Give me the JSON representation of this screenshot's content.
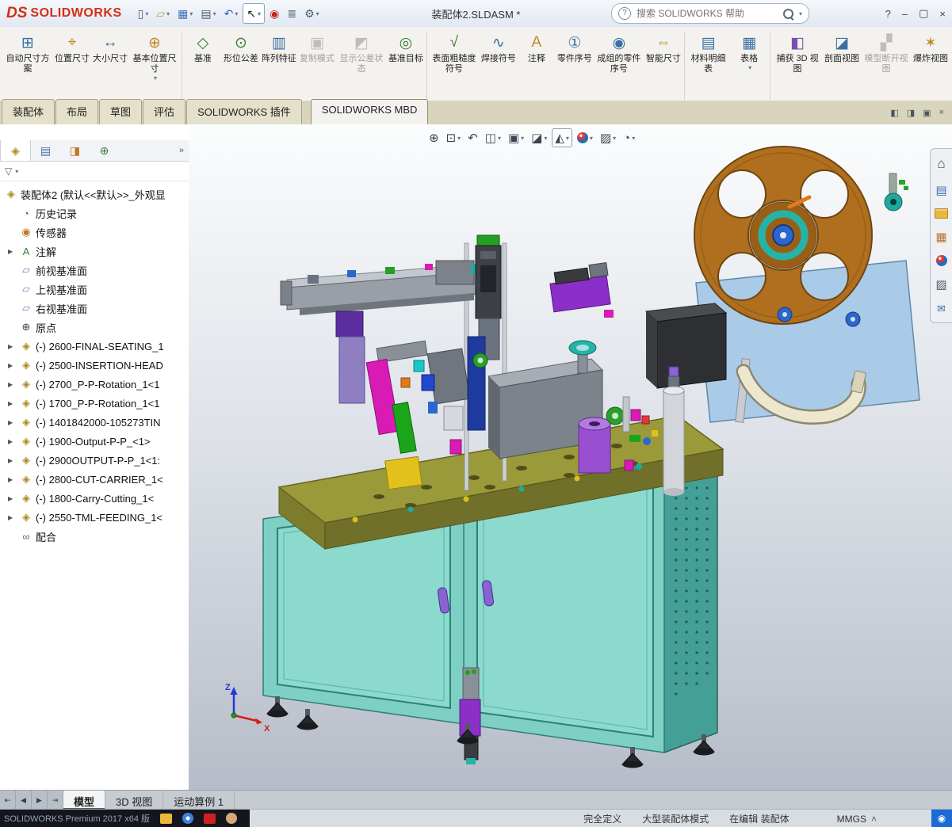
{
  "titlebar": {
    "brand_prefix": "DS",
    "brand": "SOLIDWORKS",
    "document_title": "装配体2.SLDASM *",
    "search_placeholder": "搜索 SOLIDWORKS 帮助",
    "help_glyph": "?",
    "quick_access": [
      {
        "name": "new",
        "glyph": "▯"
      },
      {
        "name": "open",
        "glyph": "▱"
      },
      {
        "name": "save",
        "glyph": "▦"
      },
      {
        "name": "print",
        "glyph": "▤"
      },
      {
        "name": "undo",
        "glyph": "↶"
      },
      {
        "name": "select",
        "glyph": "↖"
      },
      {
        "name": "rebuild-indicator",
        "glyph": "◉"
      },
      {
        "name": "file-properties",
        "glyph": "≣"
      },
      {
        "name": "options",
        "glyph": "⚙"
      }
    ],
    "window_controls": {
      "minimize": "–",
      "maximize": "▢",
      "close": "×"
    }
  },
  "ribbon": {
    "buttons": [
      {
        "label": "自动尺寸方案",
        "glyph": "⊞",
        "enabled": true,
        "dropdown": false
      },
      {
        "label": "位置尺寸",
        "glyph": "⌖",
        "enabled": true,
        "dropdown": false
      },
      {
        "label": "大小尺寸",
        "glyph": "↔",
        "enabled": true,
        "dropdown": false
      },
      {
        "label": "基本位置尺寸",
        "glyph": "⊕",
        "enabled": true,
        "dropdown": true
      },
      {
        "label": "基准",
        "glyph": "◇",
        "enabled": true,
        "dropdown": false
      },
      {
        "label": "形位公差",
        "glyph": "⊙",
        "enabled": true,
        "dropdown": false
      },
      {
        "label": "阵列特征",
        "glyph": "▥",
        "enabled": true,
        "dropdown": false
      },
      {
        "label": "复制模式",
        "glyph": "▣",
        "enabled": false,
        "dropdown": false
      },
      {
        "label": "显示公差状态",
        "glyph": "◩",
        "enabled": false,
        "dropdown": false
      },
      {
        "label": "基准目标",
        "glyph": "◎",
        "enabled": true,
        "dropdown": false
      },
      {
        "label": "表面粗糙度符号",
        "glyph": "√",
        "enabled": true,
        "dropdown": false
      },
      {
        "label": "焊接符号",
        "glyph": "∿",
        "enabled": true,
        "dropdown": false
      },
      {
        "label": "注释",
        "glyph": "A",
        "enabled": true,
        "dropdown": false
      },
      {
        "label": "零件序号",
        "glyph": "①",
        "enabled": true,
        "dropdown": false
      },
      {
        "label": "成组的零件序号",
        "glyph": "◉",
        "enabled": true,
        "dropdown": false
      },
      {
        "label": "智能尺寸",
        "glyph": "⇔",
        "enabled": true,
        "dropdown": false
      },
      {
        "label": "材料明细表",
        "glyph": "▤",
        "enabled": true,
        "dropdown": false
      },
      {
        "label": "表格",
        "glyph": "▦",
        "enabled": true,
        "dropdown": true
      },
      {
        "label": "捕获 3D 视图",
        "glyph": "◧",
        "enabled": true,
        "dropdown": false
      },
      {
        "label": "剖面视图",
        "glyph": "◪",
        "enabled": true,
        "dropdown": false
      },
      {
        "label": "模型断开视图",
        "glyph": "▞",
        "enabled": false,
        "dropdown": false
      },
      {
        "label": "爆炸视图",
        "glyph": "✶",
        "enabled": true,
        "dropdown": false
      }
    ]
  },
  "command_tabs": {
    "items": [
      "装配体",
      "布局",
      "草图",
      "评估",
      "SOLIDWORKS 插件",
      "SOLIDWORKS MBD"
    ],
    "active": "SOLIDWORKS MBD"
  },
  "feature_tree": {
    "panel_tabs": [
      {
        "name": "featuremanager",
        "glyph": "◈"
      },
      {
        "name": "propertymanager",
        "glyph": "▤"
      },
      {
        "name": "configurationmanager",
        "glyph": "◨"
      },
      {
        "name": "dimxpertmanager",
        "glyph": "⊕"
      },
      {
        "name": "displaymanager",
        "glyph": ""
      }
    ],
    "root": {
      "label": "装配体2 (默认<<默认>>_外观显",
      "glyph": "◈"
    },
    "items": [
      {
        "label": "历史记录",
        "glyph": "◔",
        "expandable": false
      },
      {
        "label": "传感器",
        "glyph": "◉",
        "expandable": false
      },
      {
        "label": "注解",
        "glyph": "A",
        "expandable": true
      },
      {
        "label": "前视基准面",
        "glyph": "▱",
        "expandable": false
      },
      {
        "label": "上视基准面",
        "glyph": "▱",
        "expandable": false
      },
      {
        "label": "右视基准面",
        "glyph": "▱",
        "expandable": false
      },
      {
        "label": "原点",
        "glyph": "⊕",
        "expandable": false
      },
      {
        "label": "(-) 2600-FINAL-SEATING_1",
        "glyph": "◈",
        "expandable": true
      },
      {
        "label": "(-) 2500-INSERTION-HEAD",
        "glyph": "◈",
        "expandable": true
      },
      {
        "label": "(-) 2700_P-P-Rotation_1<1",
        "glyph": "◈",
        "expandable": true
      },
      {
        "label": "(-) 1700_P-P-Rotation_1<1",
        "glyph": "◈",
        "expandable": true
      },
      {
        "label": "(-) 1401842000-105273TIN",
        "glyph": "◈",
        "expandable": true
      },
      {
        "label": "(-) 1900-Output-P-P_<1>",
        "glyph": "◈",
        "expandable": true
      },
      {
        "label": "(-) 2900OUTPUT-P-P_1<1:",
        "glyph": "◈",
        "expandable": true
      },
      {
        "label": "(-) 2800-CUT-CARRIER_1<",
        "glyph": "◈",
        "expandable": true
      },
      {
        "label": "(-) 1800-Carry-Cutting_1<",
        "glyph": "◈",
        "expandable": true
      },
      {
        "label": "(-) 2550-TML-FEEDING_1<",
        "glyph": "◈",
        "expandable": true
      },
      {
        "label": "配合",
        "glyph": "∞",
        "expandable": false
      }
    ]
  },
  "hud": {
    "tools": [
      {
        "name": "zoom-to-fit",
        "glyph": "⊕",
        "dropdown": false,
        "pressed": false
      },
      {
        "name": "zoom-to-area",
        "glyph": "⊡",
        "dropdown": true,
        "pressed": false
      },
      {
        "name": "previous-view",
        "glyph": "↶",
        "dropdown": false,
        "pressed": false
      },
      {
        "name": "section-view",
        "glyph": "◫",
        "dropdown": true,
        "pressed": false
      },
      {
        "name": "view-orientation",
        "glyph": "▣",
        "dropdown": true,
        "pressed": false
      },
      {
        "name": "display-style",
        "glyph": "◪",
        "dropdown": true,
        "pressed": false
      },
      {
        "name": "hide-show-items",
        "glyph": "◭",
        "dropdown": true,
        "pressed": true
      },
      {
        "name": "edit-appearance",
        "glyph": "",
        "dropdown": true,
        "pressed": false
      },
      {
        "name": "apply-scene",
        "glyph": "▨",
        "dropdown": true,
        "pressed": false
      },
      {
        "name": "view-settings",
        "glyph": "◔",
        "dropdown": true,
        "pressed": false
      }
    ]
  },
  "task_pane": {
    "icons": [
      "solidworks-resources",
      "design-library",
      "file-explorer",
      "view-palette",
      "appearances-scenes",
      "custom-properties",
      "solidworks-forum"
    ],
    "glyphs": {
      "resources": "⌂",
      "library": "▤",
      "palette": "▦",
      "properties": "▨",
      "forum": "✉"
    }
  },
  "doc_window_controls": {
    "prev": "◧",
    "next": "◨",
    "restore": "▣",
    "close": "×"
  },
  "sheet_tabs": {
    "nav": [
      "⇤",
      "◀",
      "▶",
      "⇥"
    ],
    "tabs": [
      "模型",
      "3D 视图",
      "运动算例 1"
    ],
    "active": "模型"
  },
  "statusbar": {
    "app_info": "SOLIDWORKS Premium 2017 x64 版",
    "define_state": "完全定义",
    "assembly_mode": "大型装配体模式",
    "editing": "在编辑 装配体",
    "units": "MMGS",
    "caret": "˄"
  },
  "taskbar": {
    "icons": [
      "folder",
      "browser",
      "media",
      "avatar"
    ]
  },
  "tray": {
    "glyph": "◉"
  },
  "viewport": {
    "model_description": "装配体2 assembly machine 3D model",
    "triad": {
      "z": "Z",
      "x": "X"
    }
  },
  "ui": {
    "caret": "▾",
    "funnel": "▽",
    "chevron": "»",
    "expand": "▶",
    "search_glyph": "?"
  },
  "colors": {
    "accent_red": "#d42e12",
    "cabinet_teal": "#7ed0c4",
    "deck_olive": "#9a9a3a",
    "reel_brown": "#b06f1e",
    "plate_blue": "#a9cbe7",
    "taskbar_dark": "#15161d"
  }
}
